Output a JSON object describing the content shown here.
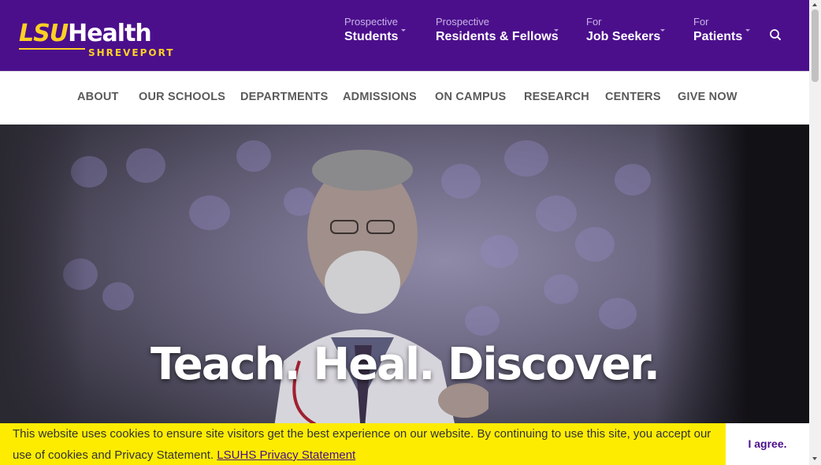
{
  "brand": {
    "logo_primary": "LSU",
    "logo_secondary": "Health",
    "logo_sub": "SHREVEPORT",
    "colors": {
      "purple": "#4b0f8c",
      "gold": "#fdd023",
      "banner": "#fdec00"
    }
  },
  "audience_nav": [
    {
      "pre": "Prospective",
      "label": "Students"
    },
    {
      "pre": "Prospective",
      "label": "Residents & Fellows"
    },
    {
      "pre": "For",
      "label": "Job Seekers"
    },
    {
      "pre": "For",
      "label": "Patients"
    }
  ],
  "search": {
    "icon": "search-icon"
  },
  "main_nav": [
    "ABOUT",
    "OUR SCHOOLS",
    "DEPARTMENTS",
    "ADMISSIONS",
    "ON CAMPUS",
    "RESEARCH",
    "CENTERS",
    "GIVE NOW"
  ],
  "hero": {
    "title": "Teach. Heal. Discover."
  },
  "cookie": {
    "text": "This website uses cookies to ensure site visitors get the best experience on our website. By continuing to use this site, you accept our use of cookies and Privacy Statement. ",
    "link": "LSUHS Privacy Statement",
    "button": "I agree."
  }
}
